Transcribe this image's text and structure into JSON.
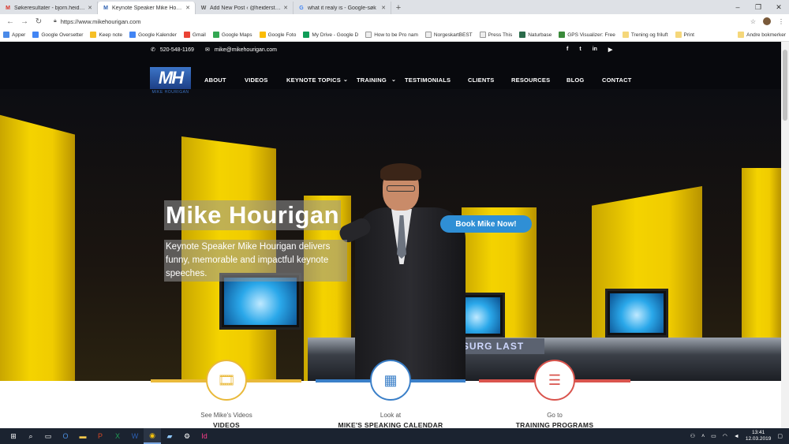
{
  "browser": {
    "tabs": [
      {
        "label": "Søkeresultater - bjorn.heiderstrom",
        "favicon": "gmail-icon"
      },
      {
        "label": "Keynote Speaker Mike Hourigan",
        "favicon": "mh-icon",
        "active": true
      },
      {
        "label": "Add New Post ‹ @heiderstrom",
        "favicon": "wordpress-icon"
      },
      {
        "label": "what it realy is - Google-søk",
        "favicon": "google-icon"
      }
    ],
    "url": "https://www.mikehourigan.com",
    "bookmarks": [
      "Apper",
      "Google Oversetter",
      "Keep note",
      "Google Kalender",
      "Gmail",
      "Google Maps",
      "Google Foto",
      "My Drive - Google D",
      "How to be Pro nam",
      "NorgeskartBEST",
      "Press This",
      "Naturbase",
      "GPS Visualizer: Free",
      "Trening og friluft",
      "Print"
    ],
    "other_bookmarks": "Andre bokmerker"
  },
  "site": {
    "phone": "520-548-1169",
    "email": "mike@mikehourigan.com",
    "logo_text": "MH",
    "logo_name": "MIKE HOURIGAN",
    "nav": [
      "ABOUT",
      "VIDEOS",
      "KEYNOTE TOPICS",
      "TRAINING",
      "TESTIMONIALS",
      "CLIENTS",
      "RESOURCES",
      "BLOG",
      "CONTACT"
    ],
    "hero_title": "Mike Hourigan",
    "hero_subtitle": "Keynote Speaker Mike Hourigan delivers funny, memorable and impactful keynote speeches.",
    "cta": "Book Mike Now!",
    "stage_sign": "SURG LAST",
    "features": [
      {
        "label": "See Mike's Videos",
        "title": "VIDEOS",
        "icon": "film-icon",
        "color": "#e9b93a"
      },
      {
        "label": "Look at",
        "title": "MIKE'S SPEAKING CALENDAR",
        "icon": "calendar-icon",
        "color": "#3a7fc8"
      },
      {
        "label": "Go to",
        "title": "TRAINING PROGRAMS",
        "icon": "list-icon",
        "color": "#d9544d"
      }
    ]
  },
  "taskbar": {
    "time": "13:41",
    "date": "12.03.2019"
  }
}
